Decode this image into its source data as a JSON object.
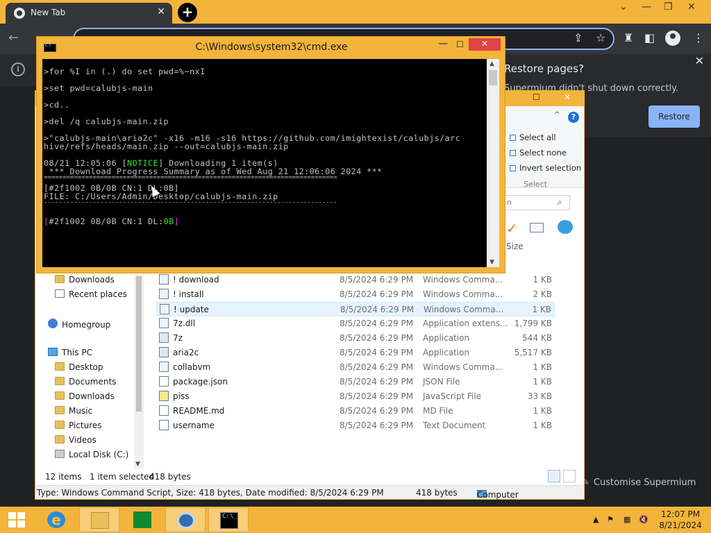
{
  "browser": {
    "tab_title": "New Tab",
    "tab_close": "✕",
    "new_tab": "+",
    "restore_bubble": {
      "title": "Restore pages?",
      "message": "Supermium didn't shut down correctly.",
      "button": "Restore",
      "close": "✕"
    },
    "customise": "Customise Supermium"
  },
  "cmd": {
    "title": "C:\\Windows\\system32\\cmd.exe",
    "lines": [
      ">for %I in (.) do set pwd=%~nxI",
      ">set pwd=calubjs-main",
      ">cd..",
      ">del /q calubjs-main.zip",
      ">\"calubjs-main\\aria2c\" -x16 -m16 -s16 https://github.com/imightexist/calubjs/arc",
      "hive/refs/heads/main.zip --out=calubjs-main.zip",
      "08/21 12:05:06 [",
      "NOTICE",
      "] Downloading 1 item(s)",
      " *** Download Progress Summary as of Wed Aug 21 12:06:06 2024 ***",
      "==============================================================================",
      "[#2f1002 0B/0B CN:1 DL:0B]",
      "FILE: C:/Users/Admin/Desktop/calubjs-main.zip",
      "------------------------------------------------------------------------------",
      "[",
      "#2f1002 0B/0B CN:1 DL:",
      "0B",
      "]"
    ]
  },
  "explorer": {
    "ribbon": {
      "select_all": "Select all",
      "select_none": "Select none",
      "invert_selection": "Invert selection",
      "group_label": "Select",
      "help": "?"
    },
    "search_placeholder": "n",
    "size_header": "Size",
    "nav": [
      {
        "label": "Downloads",
        "icon": "folder"
      },
      {
        "label": "Recent places",
        "icon": "recent"
      },
      {
        "label": "Homegroup",
        "icon": "group"
      },
      {
        "label": "This PC",
        "icon": "pc"
      },
      {
        "label": "Desktop",
        "icon": "folder"
      },
      {
        "label": "Documents",
        "icon": "folder"
      },
      {
        "label": "Downloads",
        "icon": "folder"
      },
      {
        "label": "Music",
        "icon": "folder"
      },
      {
        "label": "Pictures",
        "icon": "folder"
      },
      {
        "label": "Videos",
        "icon": "folder"
      },
      {
        "label": "Local Disk (C:)",
        "icon": "disk"
      }
    ],
    "files": [
      {
        "name": "! download",
        "date": "8/5/2024 6:29 PM",
        "type": "Windows Comma...",
        "size": "1 KB",
        "icon": "cmd"
      },
      {
        "name": "! install",
        "date": "8/5/2024 6:29 PM",
        "type": "Windows Comma...",
        "size": "2 KB",
        "icon": "cmd"
      },
      {
        "name": "! update",
        "date": "8/5/2024 6:29 PM",
        "type": "Windows Comma...",
        "size": "1 KB",
        "icon": "cmd",
        "selected": true
      },
      {
        "name": "7z.dll",
        "date": "8/5/2024 6:29 PM",
        "type": "Application extens...",
        "size": "1,799 KB",
        "icon": "cmd"
      },
      {
        "name": "7z",
        "date": "8/5/2024 6:29 PM",
        "type": "Application",
        "size": "544 KB",
        "icon": "app"
      },
      {
        "name": "aria2c",
        "date": "8/5/2024 6:29 PM",
        "type": "Application",
        "size": "5,517 KB",
        "icon": "app"
      },
      {
        "name": "collabvm",
        "date": "8/5/2024 6:29 PM",
        "type": "Windows Comma...",
        "size": "1 KB",
        "icon": "cmd"
      },
      {
        "name": "package.json",
        "date": "8/5/2024 6:29 PM",
        "type": "JSON File",
        "size": "1 KB",
        "icon": "doc"
      },
      {
        "name": "piss",
        "date": "8/5/2024 6:29 PM",
        "type": "JavaScript File",
        "size": "33 KB",
        "icon": "js"
      },
      {
        "name": "README.md",
        "date": "8/5/2024 6:29 PM",
        "type": "MD File",
        "size": "1 KB",
        "icon": "doc"
      },
      {
        "name": "username",
        "date": "8/5/2024 6:29 PM",
        "type": "Text Document",
        "size": "1 KB",
        "icon": "doc"
      }
    ],
    "status": {
      "items": "12 items",
      "selected": "1 item selected",
      "size": "418 bytes"
    },
    "details": {
      "info": "Type: Windows Command Script, Size: 418 bytes, Date modified: 8/5/2024 6:29 PM",
      "size": "418 bytes",
      "location": "Computer"
    }
  },
  "taskbar": {
    "time": "12:07 PM",
    "date": "8/21/2024",
    "cmd_glyph": "C:\\_",
    "ie_glyph": "e"
  }
}
